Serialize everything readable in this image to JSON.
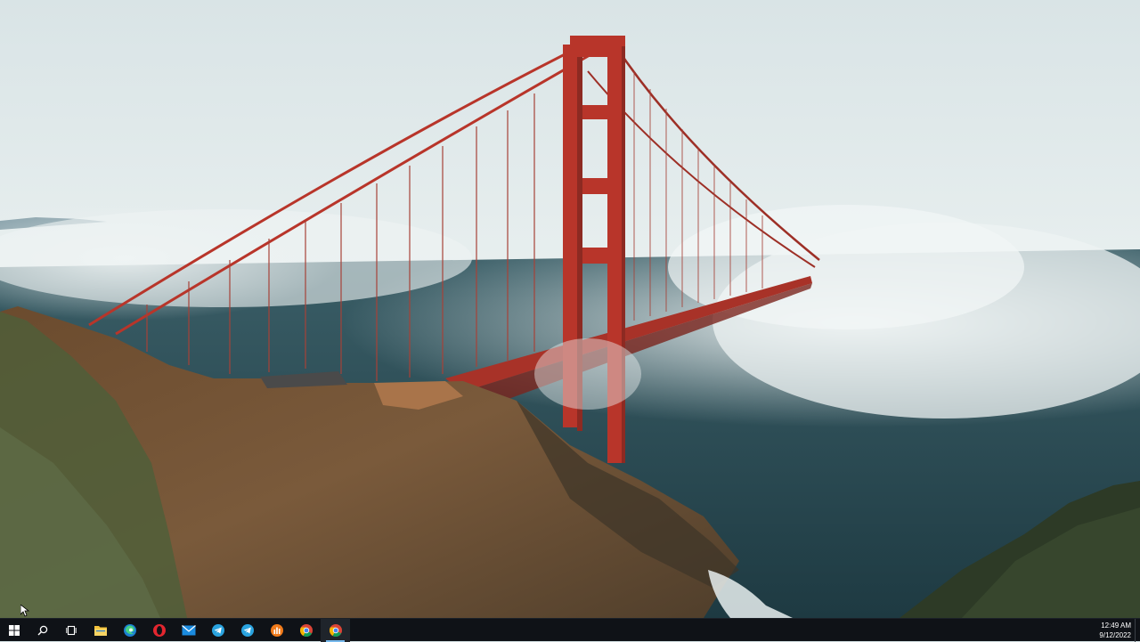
{
  "desktop": {
    "wallpaper": "Golden Gate Bridge in fog"
  },
  "taskbar": {
    "start": {
      "icon": "windows-logo-icon"
    },
    "search": {
      "icon": "search-icon"
    },
    "task_view": {
      "icon": "task-view-icon"
    },
    "pinned_apps": [
      {
        "name": "File Explorer",
        "icon": "folder-icon",
        "color": "#f3c13a",
        "active": false
      },
      {
        "name": "Microsoft Edge",
        "icon": "edge-icon",
        "color": "#2fb6e8",
        "active": false
      },
      {
        "name": "Opera",
        "icon": "opera-icon",
        "color": "#e3262f",
        "active": false
      },
      {
        "name": "Mail",
        "icon": "mail-icon",
        "color": "#1a8be0",
        "active": false
      },
      {
        "name": "Telegram",
        "icon": "telegram-icon",
        "color": "#2aa3df",
        "active": false
      },
      {
        "name": "Telegram",
        "icon": "telegram-icon",
        "color": "#2aa3df",
        "active": false
      },
      {
        "name": "Chart app",
        "icon": "orange-chart-icon",
        "color": "#f07a1a",
        "active": false
      },
      {
        "name": "Google Chrome",
        "icon": "chrome-icon",
        "color": "#4285f4",
        "active": false
      },
      {
        "name": "Google Chrome",
        "icon": "chrome-icon",
        "color": "#4285f4",
        "active": true
      }
    ],
    "clock": {
      "time": "12:49 AM",
      "date": "9/12/2022"
    }
  },
  "colors": {
    "taskbar_bg": "#0f1217",
    "active_indicator": "#76b9ed",
    "bridge_red": "#b8352a"
  }
}
